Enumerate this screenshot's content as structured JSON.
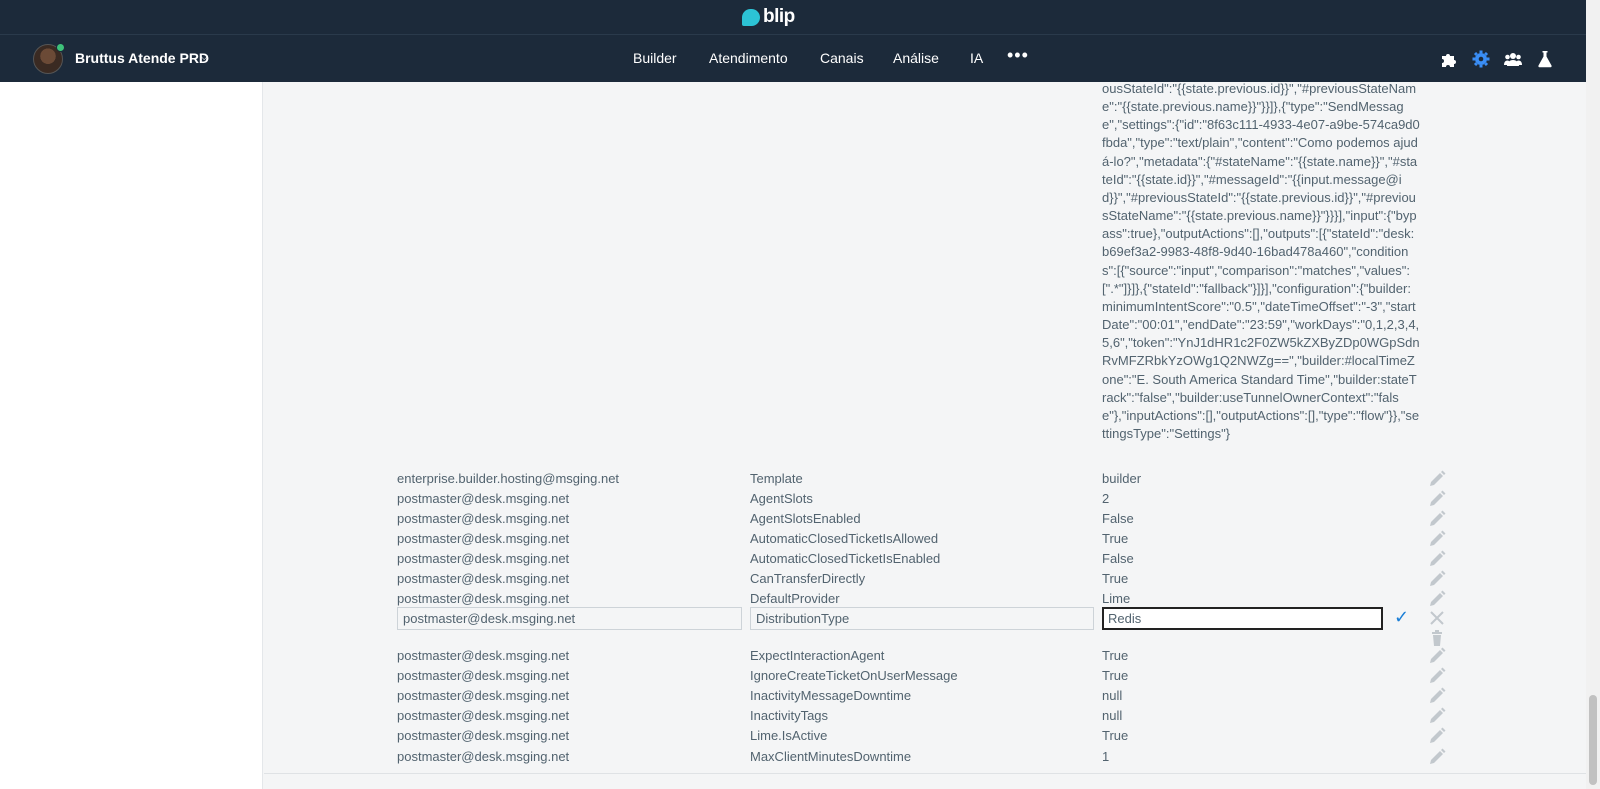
{
  "brand": {
    "name": "blip"
  },
  "nav": {
    "bot_name": "Bruttus Atende PRD",
    "items": [
      "Builder",
      "Atendimento",
      "Canais",
      "Análise",
      "IA"
    ],
    "more": "•••",
    "right_icons": [
      "puzzle-icon",
      "gear-icon",
      "team-icon",
      "flask-icon"
    ]
  },
  "json_value": "ousStateId\":\"{{state.previous.id}}\",\"#previousStateName\":\"{{state.previous.name}}\"}}]},{\"type\":\"SendMessage\",\"settings\":{\"id\":\"8f63c111-4933-4e07-a9be-574ca9d0fbda\",\"type\":\"text/plain\",\"content\":\"Como podemos ajudá-lo?\",\"metadata\":{\"#stateName\":\"{{state.name}}\",\"#stateId\":\"{{state.id}}\",\"#messageId\":\"{{input.message@id}}\",\"#previousStateId\":\"{{state.previous.id}}\",\"#previousStateName\":\"{{state.previous.name}}\"}}}],\"input\":{\"bypass\":true},\"outputActions\":[],\"outputs\":[{\"stateId\":\"desk:b69ef3a2-9983-48f8-9d40-16bad478a460\",\"conditions\":[{\"source\":\"input\",\"comparison\":\"matches\",\"values\":[\".*\"]}]},{\"stateId\":\"fallback\"}]}],\"configuration\":{\"builder:minimumIntentScore\":\"0.5\",\"dateTimeOffset\":\"-3\",\"startDate\":\"00:01\",\"endDate\":\"23:59\",\"workDays\":\"0,1,2,3,4,5,6\",\"token\":\"YnJ1dHR1c2F0ZW5kZXByZDp0WGpSdnRvMFZRbkYzOWg1Q2NWZg==\",\"builder:#localTimeZone\":\"E. South America Standard Time\",\"builder:stateTrack\":\"false\",\"builder:useTunnelOwnerContext\":\"false\"},\"inputActions\":[],\"outputActions\":[],\"type\":\"flow\"}},\"settingsType\":\"Settings\"}",
  "rows_top": [
    {
      "owner": "enterprise.builder.hosting@msging.net",
      "key": "Template",
      "value": "builder"
    },
    {
      "owner": "postmaster@desk.msging.net",
      "key": "AgentSlots",
      "value": "2"
    },
    {
      "owner": "postmaster@desk.msging.net",
      "key": "AgentSlotsEnabled",
      "value": "False"
    },
    {
      "owner": "postmaster@desk.msging.net",
      "key": "AutomaticClosedTicketIsAllowed",
      "value": "True"
    },
    {
      "owner": "postmaster@desk.msging.net",
      "key": "AutomaticClosedTicketIsEnabled",
      "value": "False"
    },
    {
      "owner": "postmaster@desk.msging.net",
      "key": "CanTransferDirectly",
      "value": "True"
    },
    {
      "owner": "postmaster@desk.msging.net",
      "key": "DefaultProvider",
      "value": "Lime"
    }
  ],
  "edit_row": {
    "owner": "postmaster@desk.msging.net",
    "key": "DistributionType",
    "value": "Redis"
  },
  "rows_bottom": [
    {
      "owner": "postmaster@desk.msging.net",
      "key": "ExpectInteractionAgent",
      "value": "True"
    },
    {
      "owner": "postmaster@desk.msging.net",
      "key": "IgnoreCreateTicketOnUserMessage",
      "value": "True"
    },
    {
      "owner": "postmaster@desk.msging.net",
      "key": "InactivityMessageDowntime",
      "value": "null"
    },
    {
      "owner": "postmaster@desk.msging.net",
      "key": "InactivityTags",
      "value": "null"
    },
    {
      "owner": "postmaster@desk.msging.net",
      "key": "Lime.IsActive",
      "value": "True"
    },
    {
      "owner": "postmaster@desk.msging.net",
      "key": "MaxClientMinutesDowntime",
      "value": "1"
    }
  ],
  "colors": {
    "header_bg": "#1c2a3a",
    "brand": "#2cc3d5",
    "accent": "#1a7ed6",
    "text": "#52636f"
  }
}
